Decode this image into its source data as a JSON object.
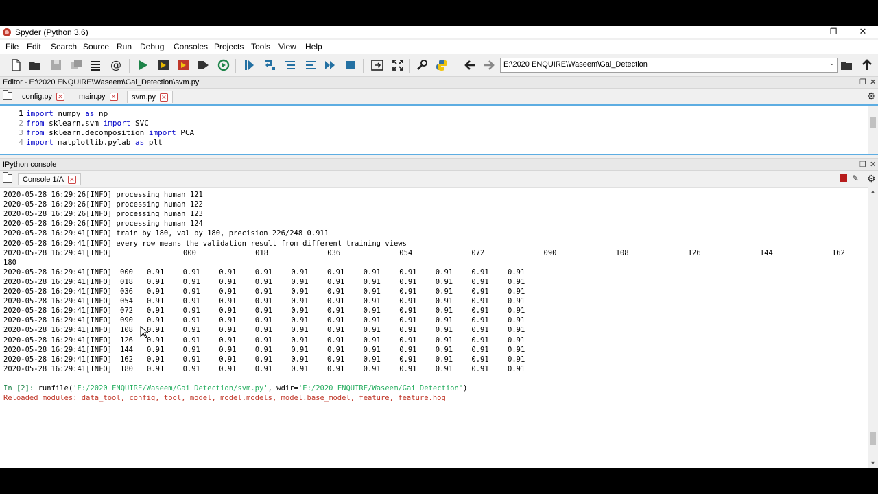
{
  "window": {
    "title": "Spyder (Python 3.6)"
  },
  "menu": [
    "File",
    "Edit",
    "Search",
    "Source",
    "Run",
    "Debug",
    "Consoles",
    "Projects",
    "Tools",
    "View",
    "Help"
  ],
  "toolbar": {
    "path": "E:\\2020 ENQUIRE\\Waseem\\Gai_Detection"
  },
  "editor": {
    "header": "Editor - E:\\2020 ENQUIRE\\Waseem\\Gai_Detection\\svm.py",
    "tabs": [
      "config.py",
      "main.py",
      "svm.py"
    ],
    "active_tab": "svm.py",
    "lines": [
      {
        "no": "1",
        "parts": [
          [
            "import",
            "kw"
          ],
          [
            " numpy ",
            ""
          ],
          [
            "as",
            "kw"
          ],
          [
            " np",
            ""
          ]
        ]
      },
      {
        "no": "2",
        "parts": [
          [
            "from",
            "kw"
          ],
          [
            " sklearn.svm ",
            ""
          ],
          [
            "import",
            "kw"
          ],
          [
            " SVC",
            ""
          ]
        ]
      },
      {
        "no": "3",
        "parts": [
          [
            "from",
            "kw"
          ],
          [
            " sklearn.decomposition ",
            ""
          ],
          [
            "import",
            "kw"
          ],
          [
            " PCA",
            ""
          ]
        ]
      },
      {
        "no": "4",
        "parts": [
          [
            "import",
            "kw"
          ],
          [
            " matplotlib.pylab ",
            ""
          ],
          [
            "as",
            "kw"
          ],
          [
            " plt",
            ""
          ]
        ]
      }
    ]
  },
  "console": {
    "header": "IPython console",
    "tab": "Console 1/A",
    "log_lines": [
      "2020-05-28 16:29:26[INFO] processing human 121",
      "2020-05-28 16:29:26[INFO] processing human 122",
      "2020-05-28 16:29:26[INFO] processing human 123",
      "2020-05-28 16:29:26[INFO] processing human 124",
      "2020-05-28 16:29:41[INFO] train by 180, val by 180, precision 226/248 0.911",
      "2020-05-28 16:29:41[INFO] every row means the validation result from different training views"
    ],
    "header_row_prefix": "2020-05-28 16:29:41[INFO]",
    "view_headers": [
      "000",
      "018",
      "036",
      "054",
      "072",
      "090",
      "108",
      "126",
      "144",
      "162"
    ],
    "wrapped_header": "180",
    "row_prefix": "2020-05-28 16:29:41[INFO]",
    "rows": [
      {
        "view": "000",
        "values": [
          "0.91",
          "0.91",
          "0.91",
          "0.91",
          "0.91",
          "0.91",
          "0.91",
          "0.91",
          "0.91",
          "0.91",
          "0.91"
        ]
      },
      {
        "view": "018",
        "values": [
          "0.91",
          "0.91",
          "0.91",
          "0.91",
          "0.91",
          "0.91",
          "0.91",
          "0.91",
          "0.91",
          "0.91",
          "0.91"
        ]
      },
      {
        "view": "036",
        "values": [
          "0.91",
          "0.91",
          "0.91",
          "0.91",
          "0.91",
          "0.91",
          "0.91",
          "0.91",
          "0.91",
          "0.91",
          "0.91"
        ]
      },
      {
        "view": "054",
        "values": [
          "0.91",
          "0.91",
          "0.91",
          "0.91",
          "0.91",
          "0.91",
          "0.91",
          "0.91",
          "0.91",
          "0.91",
          "0.91"
        ]
      },
      {
        "view": "072",
        "values": [
          "0.91",
          "0.91",
          "0.91",
          "0.91",
          "0.91",
          "0.91",
          "0.91",
          "0.91",
          "0.91",
          "0.91",
          "0.91"
        ]
      },
      {
        "view": "090",
        "values": [
          "0.91",
          "0.91",
          "0.91",
          "0.91",
          "0.91",
          "0.91",
          "0.91",
          "0.91",
          "0.91",
          "0.91",
          "0.91"
        ]
      },
      {
        "view": "108",
        "values": [
          "0.91",
          "0.91",
          "0.91",
          "0.91",
          "0.91",
          "0.91",
          "0.91",
          "0.91",
          "0.91",
          "0.91",
          "0.91"
        ]
      },
      {
        "view": "126",
        "values": [
          "0.91",
          "0.91",
          "0.91",
          "0.91",
          "0.91",
          "0.91",
          "0.91",
          "0.91",
          "0.91",
          "0.91",
          "0.91"
        ]
      },
      {
        "view": "144",
        "values": [
          "0.91",
          "0.91",
          "0.91",
          "0.91",
          "0.91",
          "0.91",
          "0.91",
          "0.91",
          "0.91",
          "0.91",
          "0.91"
        ]
      },
      {
        "view": "162",
        "values": [
          "0.91",
          "0.91",
          "0.91",
          "0.91",
          "0.91",
          "0.91",
          "0.91",
          "0.91",
          "0.91",
          "0.91",
          "0.91"
        ]
      },
      {
        "view": "180",
        "values": [
          "0.91",
          "0.91",
          "0.91",
          "0.91",
          "0.91",
          "0.91",
          "0.91",
          "0.91",
          "0.91",
          "0.91",
          "0.91"
        ]
      }
    ],
    "prompt": "In [2]:",
    "command_prefix": " runfile(",
    "command_arg1": "'E:/2020 ENQUIRE/Waseem/Gai_Detection/svm.py'",
    "command_mid": ", wdir=",
    "command_arg2": "'E:/2020 ENQUIRE/Waseem/Gai_Detection'",
    "command_suffix": ")",
    "reload_label": "Reloaded modules",
    "reload_modules": ": data_tool, config, tool, model, model.models, model.base_model, feature, feature.hog"
  }
}
